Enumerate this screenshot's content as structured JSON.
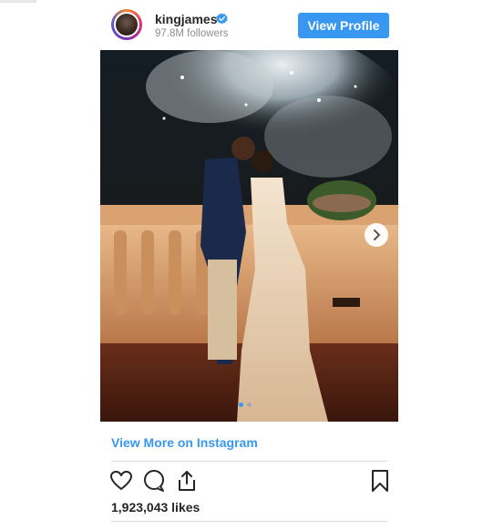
{
  "post": {
    "username": "kingjames",
    "followers": "97.8M followers",
    "view_profile_label": "View Profile",
    "view_more_label": "View More on Instagram",
    "likes": "1,923,043 likes",
    "carousel": {
      "current": 1,
      "total": 2
    }
  },
  "colors": {
    "accent": "#3897f0",
    "text": "#262626",
    "muted": "#8e8e8e",
    "divider": "#dbdbdb"
  },
  "icons": {
    "verified": "verified-badge-icon",
    "next": "chevron-right-icon",
    "like": "heart-icon",
    "comment": "comment-icon",
    "share": "share-icon",
    "save": "bookmark-icon"
  }
}
